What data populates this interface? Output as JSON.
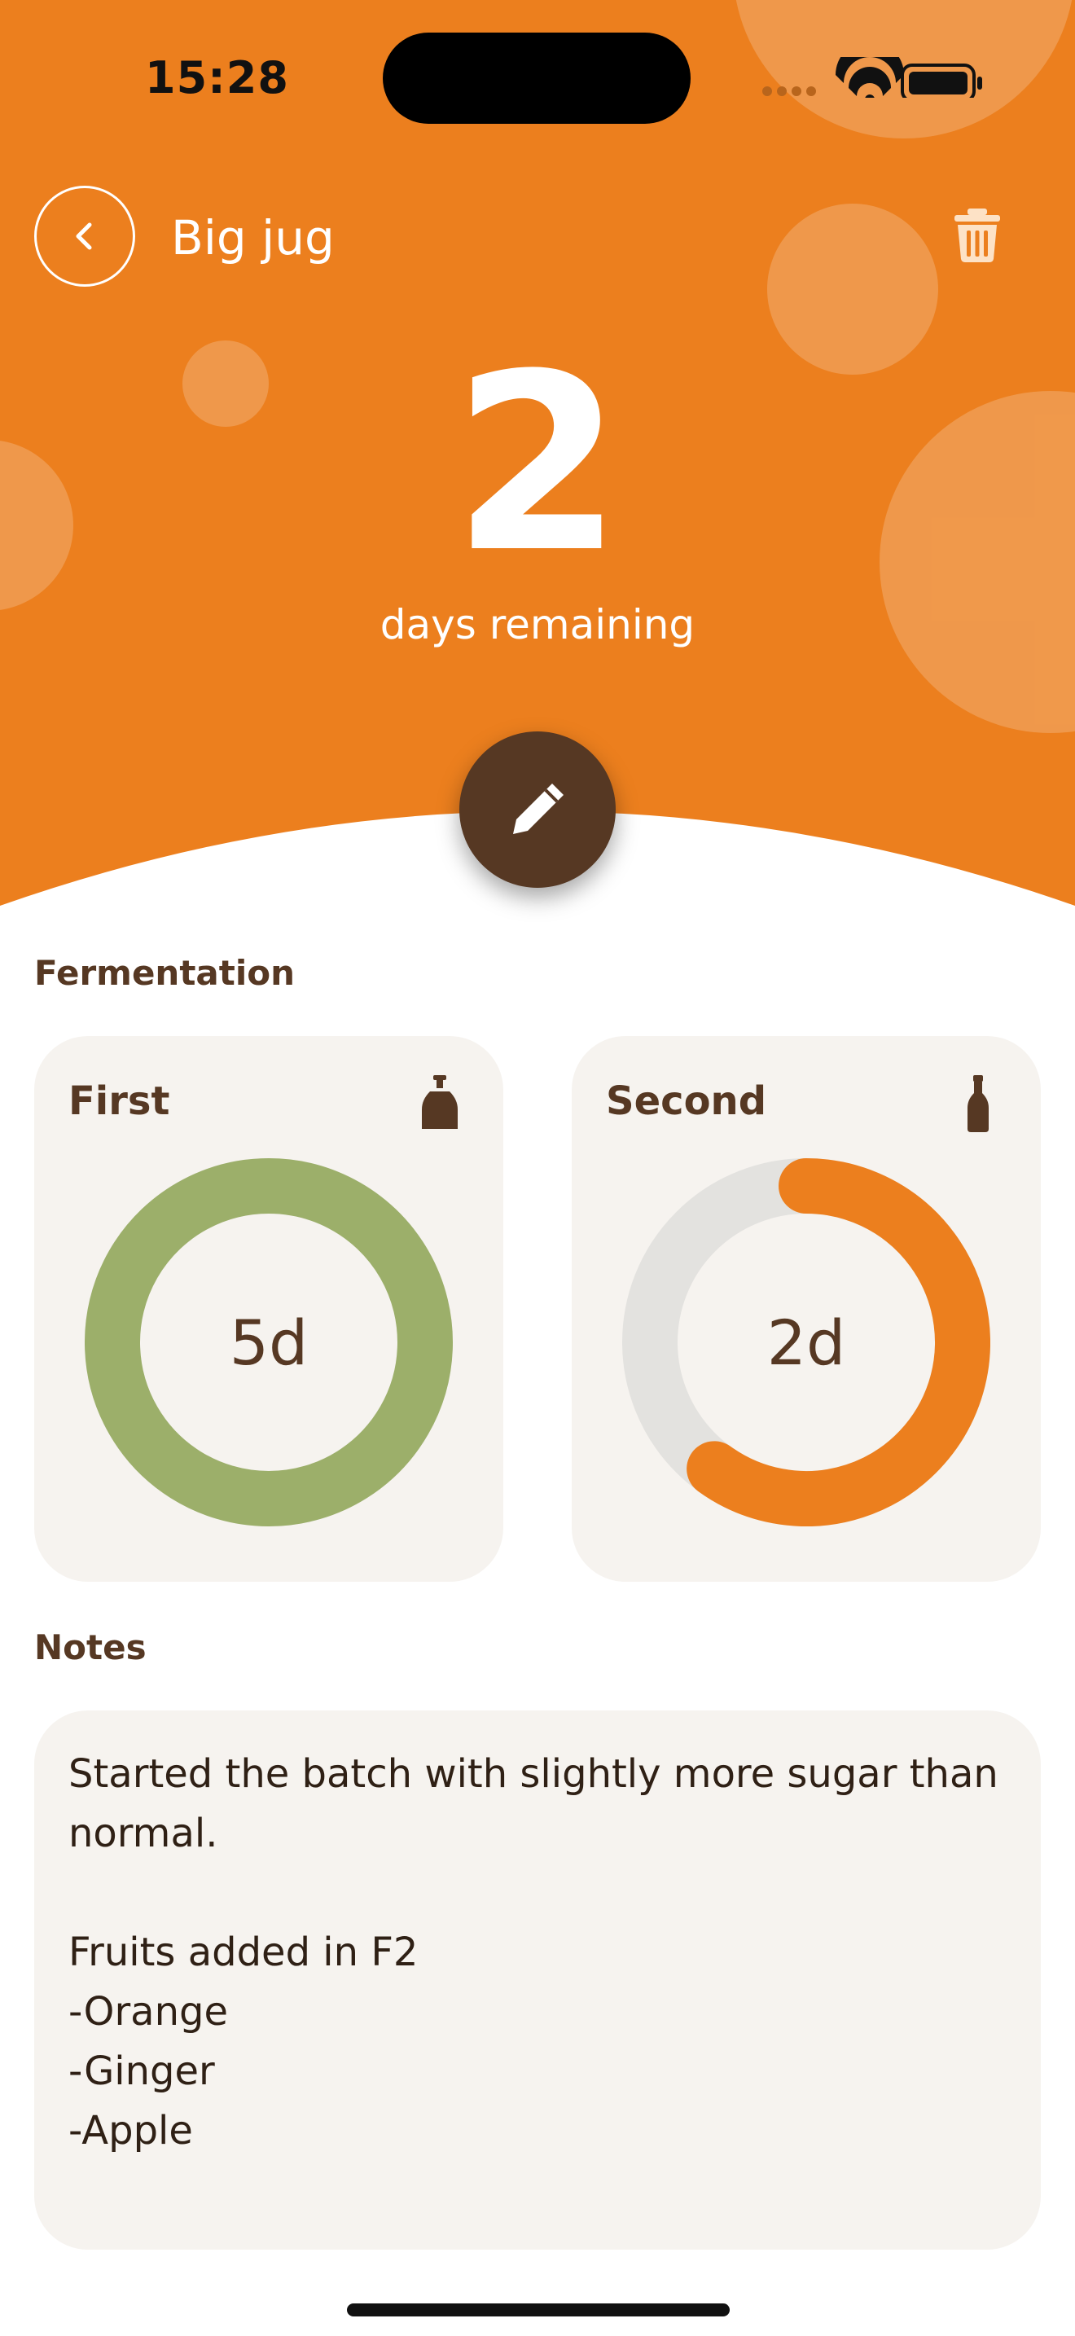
{
  "status_bar": {
    "time": "15:28"
  },
  "header": {
    "title": "Big jug",
    "days_remaining_value": "2",
    "days_remaining_label": "days remaining"
  },
  "fermentation": {
    "label": "Fermentation",
    "first": {
      "title": "First",
      "value_label": "5d",
      "progress": 1.0,
      "color": "#9caf6a"
    },
    "second": {
      "title": "Second",
      "value_label": "2d",
      "progress": 0.6,
      "color": "#ec7f1e"
    }
  },
  "notes": {
    "label": "Notes",
    "lines": [
      "Started the batch with slightly more sugar than",
      "normal.",
      "",
      "Fruits added in F2",
      "-Orange",
      "-Ginger",
      "-Apple"
    ]
  },
  "colors": {
    "accent": "#ec7f1e",
    "dark": "#563823",
    "card": "#f6f3ef",
    "green": "#9caf6a",
    "track": "#e3e2df"
  },
  "icons": [
    "back-chevron-icon",
    "trash-icon",
    "pencil-icon",
    "jug-icon",
    "bottle-icon",
    "wifi-icon",
    "battery-icon",
    "signal-icon"
  ]
}
